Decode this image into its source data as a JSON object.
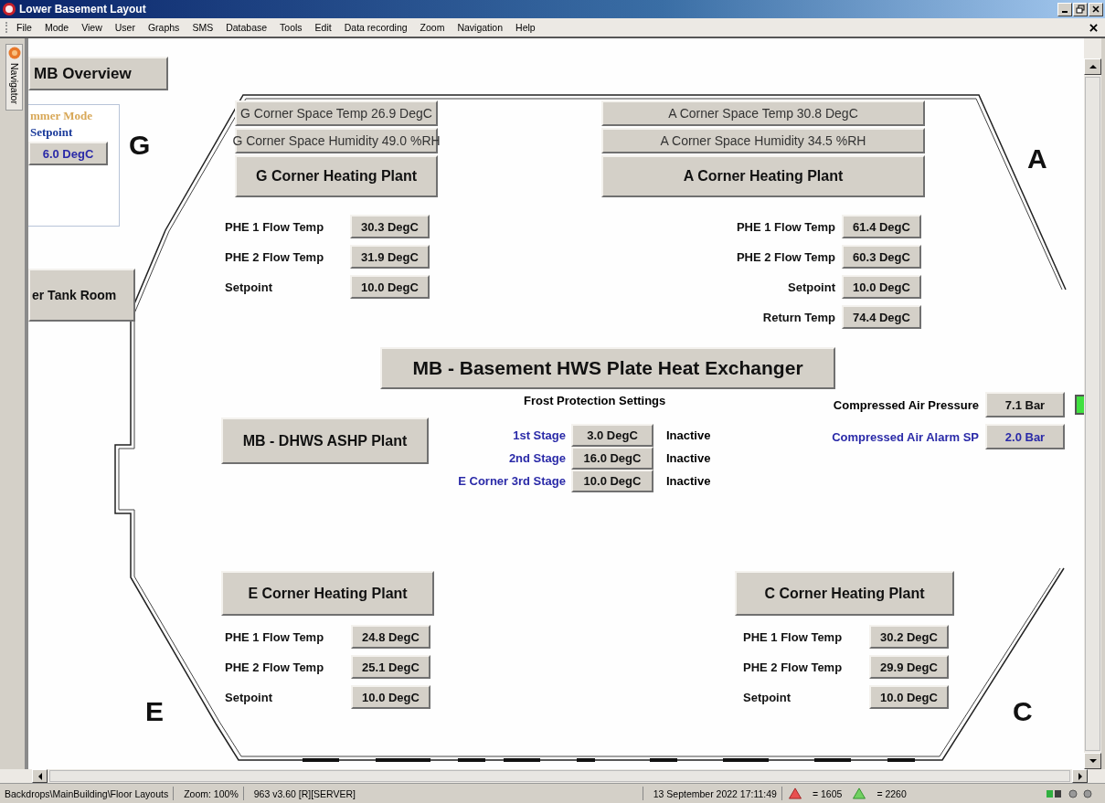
{
  "window": {
    "title": "Lower Basement Layout"
  },
  "menu": [
    "File",
    "Mode",
    "View",
    "User",
    "Graphs",
    "SMS",
    "Database",
    "Tools",
    "Edit",
    "Data recording",
    "Zoom",
    "Navigation",
    "Help"
  ],
  "navigator_tab": {
    "label": "Navigator"
  },
  "nav_buttons": [
    {
      "label": "MB Overview"
    },
    {
      "label": "er Tank Room"
    }
  ],
  "summer_mode": {
    "mode_label": "mmer Mode",
    "setpoint_label": "Setpoint",
    "setpoint_value": "6.0 DegC"
  },
  "corner_labels": [
    "G",
    "A",
    "E",
    "C"
  ],
  "plants": [
    {
      "space_readings": [
        "G Corner Space Temp 26.9 DegC",
        "G Corner Space Humidity 49.0 %RH"
      ],
      "plant": "G Corner Heating Plant",
      "readings": [
        {
          "label": "PHE 1 Flow Temp",
          "value": "30.3 DegC"
        },
        {
          "label": "PHE 2 Flow Temp",
          "value": "31.9 DegC"
        },
        {
          "label": "Setpoint",
          "value": "10.0 DegC"
        }
      ]
    },
    {
      "space_readings": [
        "A Corner Space Temp 30.8 DegC",
        "A Corner Space Humidity 34.5 %RH"
      ],
      "plant": "A Corner Heating Plant",
      "readings": [
        {
          "label": "PHE 1 Flow Temp",
          "value": "61.4 DegC"
        },
        {
          "label": "PHE 2 Flow Temp",
          "value": "60.3 DegC"
        },
        {
          "label": "Setpoint",
          "value": "10.0 DegC"
        },
        {
          "label": "Return Temp",
          "value": "74.4 DegC"
        }
      ]
    },
    {
      "plant": "E Corner Heating Plant",
      "readings": [
        {
          "label": "PHE 1 Flow Temp",
          "value": "24.8 DegC"
        },
        {
          "label": "PHE 2 Flow Temp",
          "value": "25.1 DegC"
        },
        {
          "label": "Setpoint",
          "value": "10.0 DegC"
        }
      ]
    },
    {
      "plant": "C Corner Heating Plant",
      "readings": [
        {
          "label": "PHE 1 Flow Temp",
          "value": "30.2 DegC"
        },
        {
          "label": "PHE 2 Flow Temp",
          "value": "29.9 DegC"
        },
        {
          "label": "Setpoint",
          "value": "10.0 DegC"
        }
      ]
    }
  ],
  "heat_exchanger_button": "MB - Basement HWS Plate Heat Exchanger",
  "ashp_button": "MB - DHWS ASHP Plant",
  "frost_protection": {
    "title": "Frost Protection Settings",
    "stages": [
      {
        "label": "1st Stage",
        "value": "3.0 DegC",
        "status": "Inactive"
      },
      {
        "label": "2nd Stage",
        "value": "16.0 DegC",
        "status": "Inactive"
      },
      {
        "label": "E Corner 3rd Stage",
        "value": "10.0 DegC",
        "status": "Inactive"
      }
    ]
  },
  "compressed_air": {
    "pressure_label": "Compressed Air Pressure",
    "pressure_value": "7.1 Bar",
    "alarm_label": "Compressed Air Alarm SP",
    "alarm_value": "2.0 Bar",
    "indicator": {
      "on": true
    }
  },
  "status_bar": {
    "path": "Backdrops\\MainBuilding\\Floor Layouts",
    "zoom": "Zoom: 100%",
    "version": "963 v3.60 [R][SERVER]",
    "datetime": "13 September 2022 17:11:49",
    "red_count": "= 1605",
    "green_count": "= 2260"
  }
}
